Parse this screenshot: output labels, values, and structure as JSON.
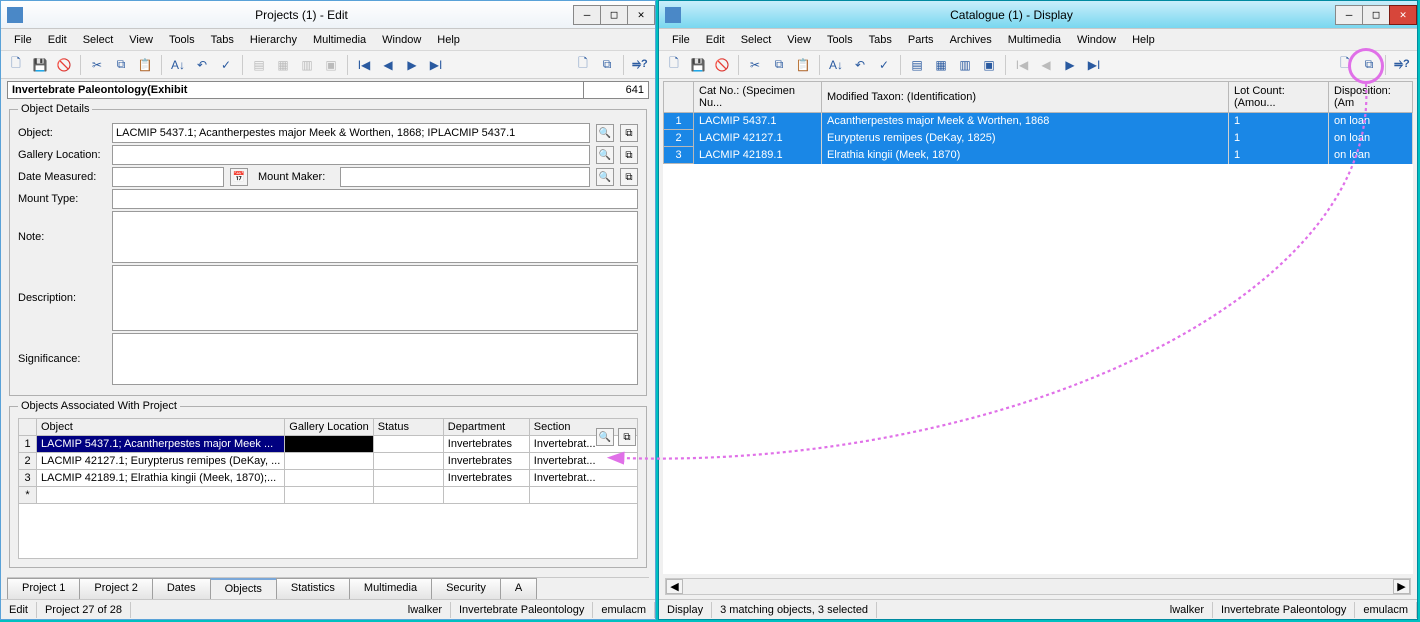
{
  "w1": {
    "title": "Projects (1) - Edit",
    "menus": [
      "File",
      "Edit",
      "Select",
      "View",
      "Tools",
      "Tabs",
      "Hierarchy",
      "Multimedia",
      "Window",
      "Help"
    ],
    "titleline_main": "Invertebrate Paleontology(Exhibit",
    "titleline_num": "641",
    "fields": {
      "object_label": "Object:",
      "object_value": "LACMIP 5437.1; Acantherpestes major Meek & Worthen, 1868; IPLACMIP 5437.1",
      "gallery_label": "Gallery Location:",
      "date_label": "Date Measured:",
      "mountmaker_label": "Mount Maker:",
      "mounttype_label": "Mount Type:",
      "note_label": "Note:",
      "description_label": "Description:",
      "significance_label": "Significance:"
    },
    "legend1": "Object Details",
    "legend2": "Objects Associated With Project",
    "assoc_cols": [
      "Object",
      "Gallery Location",
      "Status",
      "Department",
      "Section"
    ],
    "assoc_rows": [
      {
        "n": "1",
        "obj": "LACMIP 5437.1; Acantherpestes major Meek ...",
        "gal": "",
        "st": "",
        "dep": "Invertebrates",
        "sec": "Invertebrat..."
      },
      {
        "n": "2",
        "obj": "LACMIP 42127.1; Eurypterus remipes (DeKay, ...",
        "gal": "",
        "st": "",
        "dep": "Invertebrates",
        "sec": "Invertebrat..."
      },
      {
        "n": "3",
        "obj": "LACMIP 42189.1; Elrathia kingii (Meek, 1870);...",
        "gal": "",
        "st": "",
        "dep": "Invertebrates",
        "sec": "Invertebrat..."
      }
    ],
    "tabs": [
      "Project 1",
      "Project 2",
      "Dates",
      "Objects",
      "Statistics",
      "Multimedia",
      "Security",
      "A"
    ],
    "active_tab": 3,
    "status": {
      "mode": "Edit",
      "pos": "Project 27 of 28",
      "user": "lwalker",
      "dept": "Invertebrate Paleontology",
      "db": "emulacm"
    }
  },
  "w2": {
    "title": "Catalogue (1) - Display",
    "menus": [
      "File",
      "Edit",
      "Select",
      "View",
      "Tools",
      "Tabs",
      "Parts",
      "Archives",
      "Multimedia",
      "Window",
      "Help"
    ],
    "cols": [
      "",
      "Cat No.: (Specimen Nu...",
      "Modified Taxon: (Identification)",
      "Lot Count: (Amou...",
      "Disposition: (Am"
    ],
    "rows": [
      {
        "n": "1",
        "cat": "LACMIP 5437.1",
        "taxon": "Acantherpestes major Meek & Worthen, 1868",
        "lot": "1",
        "disp": "on loan"
      },
      {
        "n": "2",
        "cat": "LACMIP 42127.1",
        "taxon": "Eurypterus remipes (DeKay, 1825)",
        "lot": "1",
        "disp": "on loan"
      },
      {
        "n": "3",
        "cat": "LACMIP 42189.1",
        "taxon": "Elrathia kingii (Meek, 1870)",
        "lot": "1",
        "disp": "on loan"
      }
    ],
    "status": {
      "mode": "Display",
      "sel": "3 matching objects, 3 selected",
      "user": "lwalker",
      "dept": "Invertebrate Paleontology",
      "db": "emulacm"
    }
  }
}
